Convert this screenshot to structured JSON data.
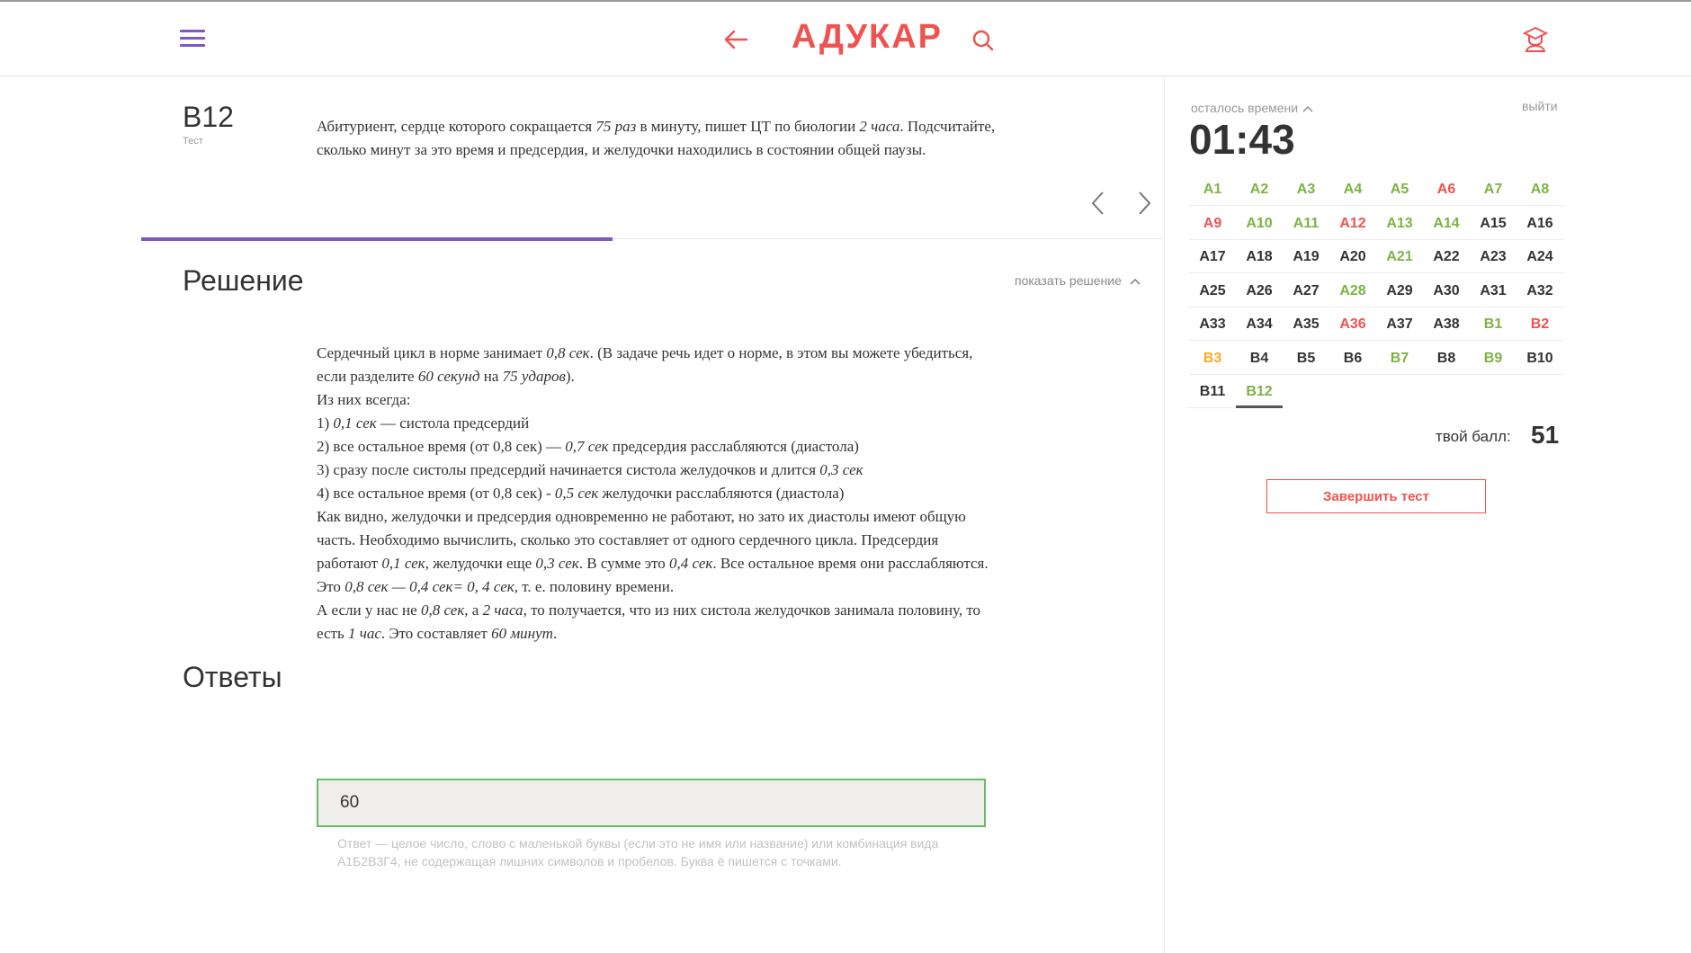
{
  "header": {
    "logo": "АДУКАР",
    "brand_color": "#ef5350",
    "accent_color": "#7e57c2",
    "icons": [
      "menu-icon",
      "back-arrow-icon",
      "search-icon",
      "user-icon"
    ]
  },
  "question": {
    "code": "B12",
    "subtitle": "Тест",
    "text_parts": [
      {
        "t": "Абитуриент, сердце которого сокращается "
      },
      {
        "t": "75 раз",
        "i": true
      },
      {
        "t": " в минуту, пишет ЦТ по биологии "
      },
      {
        "t": "2 часа",
        "i": true
      },
      {
        "t": ". Подсчитайте, сколько минут за это время и предсердия, и желудочки находились в состоянии общей паузы."
      }
    ]
  },
  "solution": {
    "heading": "Решение",
    "toggle_label": "показать решение",
    "lines": [
      [
        {
          "t": "Сердечный цикл в норме занимает "
        },
        {
          "t": "0,8 сек",
          "i": true
        },
        {
          "t": ". (В задаче речь идет о норме, в этом вы можете убедиться, если разделите "
        },
        {
          "t": "60 секунд",
          "i": true
        },
        {
          "t": " на "
        },
        {
          "t": "75 ударов",
          "i": true
        },
        {
          "t": ")."
        }
      ],
      [
        {
          "t": "Из них всегда:"
        }
      ],
      [
        {
          "t": "1) "
        },
        {
          "t": "0,1 сек",
          "i": true
        },
        {
          "t": " — систола предсердий"
        }
      ],
      [
        {
          "t": "2) все остальное время (от 0,8 сек) — "
        },
        {
          "t": "0,7 сек",
          "i": true
        },
        {
          "t": " предсердия расслабляются (диастола)"
        }
      ],
      [
        {
          "t": "3) сразу после систолы предсердий начинается систола желудочков и длится "
        },
        {
          "t": "0,3 сек",
          "i": true
        }
      ],
      [
        {
          "t": "4) все остальное время (от 0,8 сек) - "
        },
        {
          "t": "0,5 сек",
          "i": true
        },
        {
          "t": " желудочки расслабляются (диастола)"
        }
      ],
      [
        {
          "t": "Как видно, желудочки и предсердия одновременно не работают, но зато их диастолы имеют общую часть. Необходимо вычислить, сколько это составляет от одного сердечного цикла. Предсердия работают "
        },
        {
          "t": "0,1 сек",
          "i": true
        },
        {
          "t": ", желудочки еще "
        },
        {
          "t": "0,3 сек",
          "i": true
        },
        {
          "t": ". В сумме это "
        },
        {
          "t": "0,4 сек",
          "i": true
        },
        {
          "t": ". Все остальное время они расслабляются. Это "
        },
        {
          "t": "0,8 сек — 0,4 сек= 0, 4 сек",
          "i": true
        },
        {
          "t": ", т. е. половину времени."
        }
      ],
      [
        {
          "t": "А если у нас не "
        },
        {
          "t": "0,8 сек",
          "i": true
        },
        {
          "t": ", а "
        },
        {
          "t": "2 часа",
          "i": true
        },
        {
          "t": ", то получается, что из них систола желудочков занимала половину, то есть "
        },
        {
          "t": "1 час",
          "i": true
        },
        {
          "t": ". Это составляет "
        },
        {
          "t": "60 минут",
          "i": true
        },
        {
          "t": "."
        }
      ]
    ]
  },
  "answers": {
    "heading": "Ответы",
    "value": "60",
    "hint": "Ответ — целое число, слово с маленькой буквы (если это не имя или название) или комбинация вида А1Б2В3Г4, не содержащая лишних символов и пробелов. Буква ё пишется с точками."
  },
  "sidebar": {
    "timer_label": "осталось времени",
    "timer": "01:43",
    "exit_label": "выйти",
    "score_label": "твой балл:",
    "score": "51",
    "finish_label": "Завершить тест",
    "items": [
      {
        "l": "A1",
        "s": "green"
      },
      {
        "l": "A2",
        "s": "green"
      },
      {
        "l": "A3",
        "s": "green"
      },
      {
        "l": "A4",
        "s": "green"
      },
      {
        "l": "A5",
        "s": "green"
      },
      {
        "l": "A6",
        "s": "red"
      },
      {
        "l": "A7",
        "s": "green"
      },
      {
        "l": "A8",
        "s": "green"
      },
      {
        "l": "A9",
        "s": "red"
      },
      {
        "l": "A10",
        "s": "green"
      },
      {
        "l": "A11",
        "s": "green"
      },
      {
        "l": "A12",
        "s": "red"
      },
      {
        "l": "A13",
        "s": "green"
      },
      {
        "l": "A14",
        "s": "green"
      },
      {
        "l": "A15",
        "s": "none"
      },
      {
        "l": "A16",
        "s": "none"
      },
      {
        "l": "A17",
        "s": "none"
      },
      {
        "l": "A18",
        "s": "none"
      },
      {
        "l": "A19",
        "s": "none"
      },
      {
        "l": "A20",
        "s": "none"
      },
      {
        "l": "A21",
        "s": "green"
      },
      {
        "l": "A22",
        "s": "none"
      },
      {
        "l": "A23",
        "s": "none"
      },
      {
        "l": "A24",
        "s": "none"
      },
      {
        "l": "A25",
        "s": "none"
      },
      {
        "l": "A26",
        "s": "none"
      },
      {
        "l": "A27",
        "s": "none"
      },
      {
        "l": "A28",
        "s": "green"
      },
      {
        "l": "A29",
        "s": "none"
      },
      {
        "l": "A30",
        "s": "none"
      },
      {
        "l": "A31",
        "s": "none"
      },
      {
        "l": "A32",
        "s": "none"
      },
      {
        "l": "A33",
        "s": "none"
      },
      {
        "l": "A34",
        "s": "none"
      },
      {
        "l": "A35",
        "s": "none"
      },
      {
        "l": "A36",
        "s": "red"
      },
      {
        "l": "A37",
        "s": "none"
      },
      {
        "l": "A38",
        "s": "none"
      },
      {
        "l": "B1",
        "s": "green"
      },
      {
        "l": "B2",
        "s": "red"
      },
      {
        "l": "B3",
        "s": "orange"
      },
      {
        "l": "B4",
        "s": "none"
      },
      {
        "l": "B5",
        "s": "none"
      },
      {
        "l": "B6",
        "s": "none"
      },
      {
        "l": "B7",
        "s": "green"
      },
      {
        "l": "B8",
        "s": "none"
      },
      {
        "l": "B9",
        "s": "green"
      },
      {
        "l": "B10",
        "s": "none"
      },
      {
        "l": "B11",
        "s": "none"
      },
      {
        "l": "B12",
        "s": "green",
        "current": true
      }
    ]
  }
}
